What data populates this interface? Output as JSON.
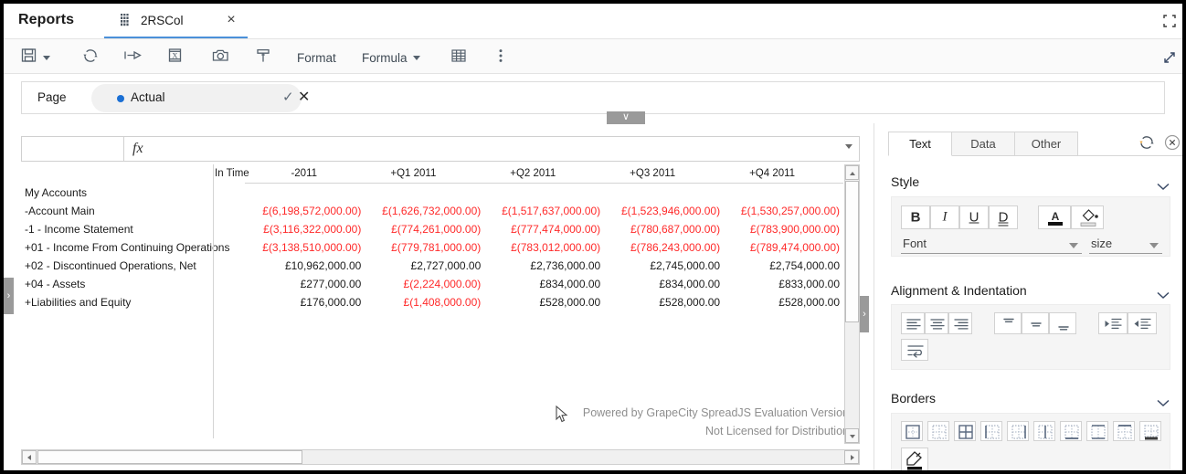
{
  "window": {
    "app_title": "Reports",
    "expand_icon": "expand-window-icon",
    "resize_icon": "resize-handle-icon"
  },
  "document_tab": {
    "label": "2RSCol",
    "icon": "spreadsheet-icon",
    "close": "×"
  },
  "toolbar": {
    "save_label": "save-icon",
    "refresh_label": "refresh-icon",
    "publish_label": "publish-arrow-icon",
    "export_excel_label": "export-excel-icon",
    "snapshot_label": "camera-icon",
    "format_painter_label": "format-painter-icon",
    "format_text": "Format",
    "formula_text": "Formula",
    "table_label": "table-grid-icon",
    "more_label": "more-options-icon"
  },
  "page_filter": {
    "label": "Page",
    "value": "Actual",
    "confirm": "✓",
    "cancel": "✕",
    "collapse_glyph": "∨"
  },
  "formula_bar": {
    "name_box_value": "",
    "fx_glyph": "fx",
    "formula_value": "",
    "expand_glyph": "∨"
  },
  "grid": {
    "corner_header": "In Time",
    "columns": [
      "-2011",
      "+Q1 2011",
      "+Q2 2011",
      "+Q3 2011",
      "+Q4 2011"
    ],
    "rows": [
      {
        "label": "My Accounts",
        "values": [
          "",
          "",
          "",
          "",
          ""
        ],
        "negative": [
          false,
          false,
          false,
          false,
          false
        ]
      },
      {
        "label": "-Account Main",
        "values": [
          "£(6,198,572,000.00)",
          "£(1,626,732,000.00)",
          "£(1,517,637,000.00)",
          "£(1,523,946,000.00)",
          "£(1,530,257,000.00)"
        ],
        "negative": [
          true,
          true,
          true,
          true,
          true
        ]
      },
      {
        "label": "-1 - Income Statement",
        "values": [
          "£(3,116,322,000.00)",
          "£(774,261,000.00)",
          "£(777,474,000.00)",
          "£(780,687,000.00)",
          "£(783,900,000.00)"
        ],
        "negative": [
          true,
          true,
          true,
          true,
          true
        ]
      },
      {
        "label": "+01 - Income From Continuing Operations",
        "values": [
          "£(3,138,510,000.00)",
          "£(779,781,000.00)",
          "£(783,012,000.00)",
          "£(786,243,000.00)",
          "£(789,474,000.00)"
        ],
        "negative": [
          true,
          true,
          true,
          true,
          true
        ]
      },
      {
        "label": "+02 - Discontinued Operations, Net",
        "values": [
          "£10,962,000.00",
          "£2,727,000.00",
          "£2,736,000.00",
          "£2,745,000.00",
          "£2,754,000.00"
        ],
        "negative": [
          false,
          false,
          false,
          false,
          false
        ]
      },
      {
        "label": "+04 - Assets",
        "values": [
          "£277,000.00",
          "£(2,224,000.00)",
          "£834,000.00",
          "£834,000.00",
          "£833,000.00"
        ],
        "negative": [
          false,
          true,
          false,
          false,
          false
        ]
      },
      {
        "label": "+Liabilities and Equity",
        "values": [
          "£176,000.00",
          "£(1,408,000.00)",
          "£528,000.00",
          "£528,000.00",
          "£528,000.00"
        ],
        "negative": [
          false,
          true,
          false,
          false,
          false
        ]
      }
    ],
    "watermark_line1": "Powered by GrapeCity SpreadJS Evaluation Version",
    "watermark_line2": "Not Licensed for Distribution"
  },
  "splitters": {
    "left_glyph": "›",
    "right_glyph": "›"
  },
  "side_panel": {
    "tabs": [
      {
        "label": "Text",
        "active": true
      },
      {
        "label": "Data",
        "active": false
      },
      {
        "label": "Other",
        "active": false
      }
    ],
    "refresh_icon": "refresh-icon",
    "close_icon": "close-circle-icon",
    "sections": [
      {
        "title": "Style",
        "chevron": "chevron-down-icon"
      },
      {
        "title": "Alignment & Indentation",
        "chevron": "chevron-down-icon"
      },
      {
        "title": "Borders",
        "chevron": "chevron-down-icon"
      }
    ],
    "style": {
      "bold": "B",
      "italic": "I",
      "underline": "U",
      "double_underline": "D",
      "font_color_icon": "font-color-icon",
      "fill_color_icon": "fill-color-icon",
      "font_placeholder": "Font",
      "size_placeholder": "size"
    },
    "alignment": {
      "align_left": "align-left-icon",
      "align_center": "align-center-icon",
      "align_right": "align-right-icon",
      "valign_top": "vertical-align-top-icon",
      "valign_middle": "vertical-align-middle-icon",
      "valign_bottom": "vertical-align-bottom-icon",
      "decrease_indent": "decrease-indent-icon",
      "increase_indent": "increase-indent-icon",
      "wrap_text": "wrap-text-icon"
    },
    "borders": [
      "border-box-icon",
      "border-none-icon",
      "border-all-icon",
      "border-left-icon",
      "border-right-icon",
      "border-inner-vertical-icon",
      "border-bottom-icon",
      "border-top-bottom-icon",
      "border-top-icon",
      "border-thick-bottom-icon"
    ],
    "border_color_icon": "border-color-picker-icon"
  },
  "colors": {
    "accent": "#4a90d9",
    "filter_dot": "#1a6fd4",
    "negative_value": "#ff2a2a",
    "toolbar_icon": "#55616d",
    "watermark": "#8e8e8e"
  }
}
